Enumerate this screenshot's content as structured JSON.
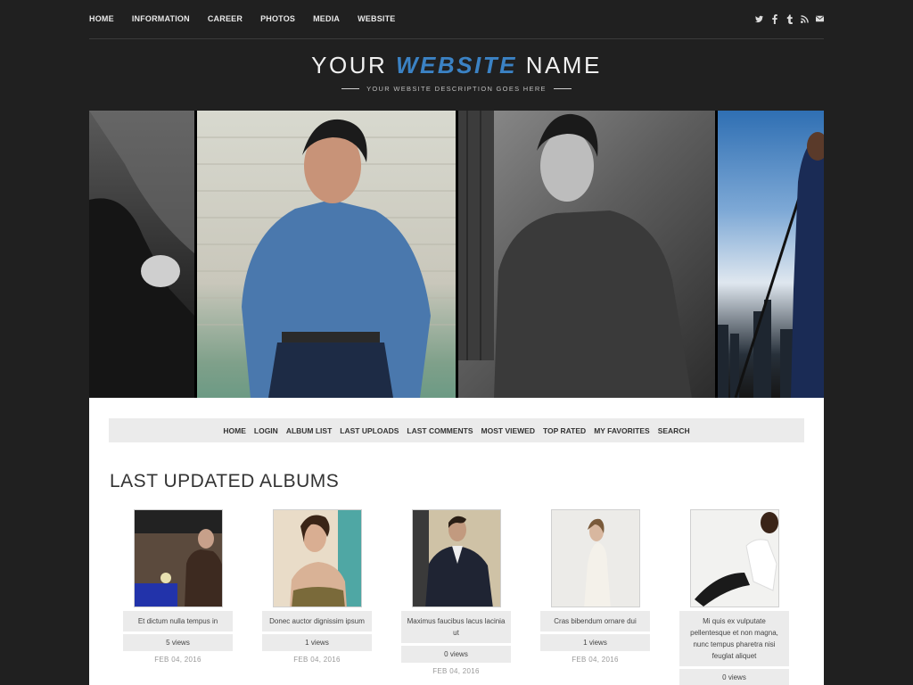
{
  "topnav": {
    "items": [
      "HOME",
      "INFORMATION",
      "CAREER",
      "PHOTOS",
      "MEDIA",
      "WEBSITE"
    ],
    "social": [
      {
        "icon": "twitter-icon",
        "glyph": "🐦"
      },
      {
        "icon": "facebook-icon",
        "glyph": "f"
      },
      {
        "icon": "tumblr-icon",
        "glyph": "t"
      },
      {
        "icon": "rss-icon",
        "glyph": "◉"
      },
      {
        "icon": "email-icon",
        "glyph": "✉"
      }
    ]
  },
  "brand": {
    "name_pre": "YOUR ",
    "name_accent": "WEBSITE",
    "name_post": " NAME",
    "tagline": "YOUR WEBSITE DESCRIPTION GOES HERE",
    "accent_color": "#3b82c4"
  },
  "subnav": [
    "HOME",
    "LOGIN",
    "ALBUM LIST",
    "LAST UPLOADS",
    "LAST COMMENTS",
    "MOST VIEWED",
    "TOP RATED",
    "MY FAVORITES",
    "SEARCH"
  ],
  "section_title": "LAST UPDATED ALBUMS",
  "albums": [
    {
      "title": "Et dictum nulla tempus in",
      "views": "5 views",
      "date": "FEB 04, 2016"
    },
    {
      "title": "Donec auctor dignissim ipsum",
      "views": "1 views",
      "date": "FEB 04, 2016"
    },
    {
      "title": "Maximus faucibus lacus lacinia ut",
      "views": "0 views",
      "date": "FEB 04, 2016"
    },
    {
      "title": "Cras bibendum ornare dui",
      "views": "1 views",
      "date": "FEB 04, 2016"
    },
    {
      "title": "Mi quis ex vulputate pellentesque et non magna, nunc tempus pharetra nisi feuglat aliquet",
      "views": "0 views",
      "date": ""
    }
  ]
}
